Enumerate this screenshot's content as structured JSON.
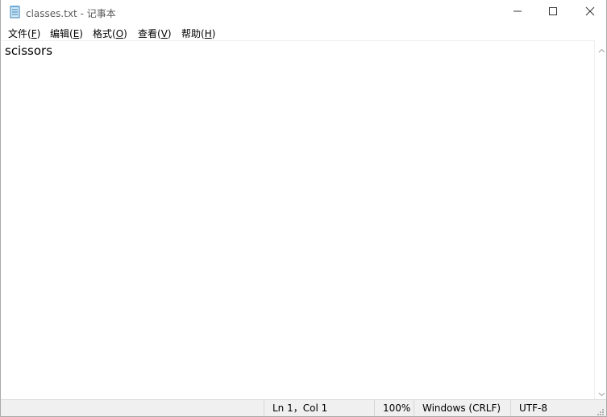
{
  "window": {
    "title": "classes.txt - 记事本",
    "file_icon": "notepad-file-icon",
    "controls": {
      "minimize_icon": "minimize-icon",
      "maximize_icon": "maximize-icon",
      "close_icon": "close-icon"
    }
  },
  "menu": [
    {
      "label": "文件(",
      "key": "F",
      "tail": ")"
    },
    {
      "label": "编辑(",
      "key": "E",
      "tail": ")"
    },
    {
      "label": "格式(",
      "key": "O",
      "tail": ")"
    },
    {
      "label": "查看(",
      "key": "V",
      "tail": ")"
    },
    {
      "label": "帮助(",
      "key": "H",
      "tail": ")"
    }
  ],
  "editor": {
    "content": "scissors"
  },
  "status": {
    "position": "Ln 1，Col 1",
    "zoom": "100%",
    "line_ending": "Windows (CRLF)",
    "encoding": "UTF-8"
  },
  "colors": {
    "title_text": "#5a5a5a",
    "statusbar_bg": "#f0f0f0",
    "border": "#d7d7d7"
  }
}
